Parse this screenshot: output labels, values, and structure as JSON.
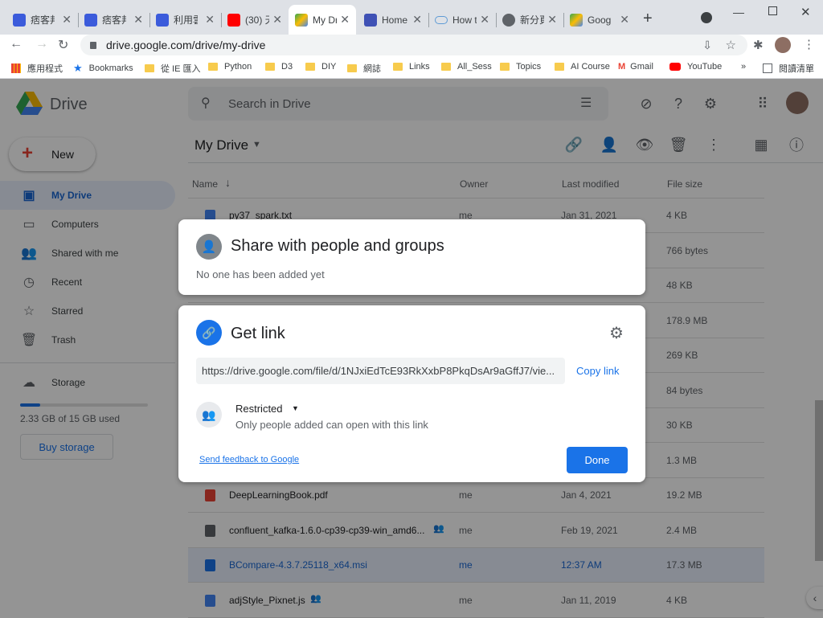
{
  "browser": {
    "tabs": [
      {
        "label": "痞客邦",
        "color": "#3b5bdb"
      },
      {
        "label": "痞客邦",
        "color": "#3b5bdb"
      },
      {
        "label": "利用雲",
        "color": "#3b5bdb"
      },
      {
        "label": "(30) 天",
        "color": "#ff0000"
      },
      {
        "label": "My Dri",
        "color": "#1a73e8"
      },
      {
        "label": "Home",
        "color": "#3f51b5"
      },
      {
        "label": "How t",
        "color": "#5f9bd5"
      },
      {
        "label": "新分頁",
        "color": "#5f6368"
      },
      {
        "label": "Googl",
        "color": "#1a73e8"
      }
    ],
    "url": "drive.google.com/drive/my-drive",
    "bookmarks": [
      "應用程式",
      "Bookmarks",
      "從 IE 匯入",
      "Python",
      "D3",
      "DIY",
      "網誌",
      "Links",
      "All_Sess",
      "Topics",
      "AI Course",
      "Gmail",
      "YouTube"
    ],
    "reading_list": "閱讀清單",
    "more": "»"
  },
  "drive": {
    "logo_text": "Drive",
    "search_placeholder": "Search in Drive",
    "new_label": "New",
    "breadcrumb": "My Drive",
    "nav": [
      "My Drive",
      "Computers",
      "Shared with me",
      "Recent",
      "Starred",
      "Trash",
      "Storage"
    ],
    "storage_text": "2.33 GB of 15 GB used",
    "storage_fraction": 0.155,
    "buy_storage": "Buy storage",
    "columns": [
      "Name",
      "Owner",
      "Last modified",
      "File size"
    ],
    "rows": [
      {
        "name": "py37_spark.txt",
        "owner": "me",
        "modified": "Jan 31, 2021",
        "size": "4 KB",
        "icon": "doc"
      },
      {
        "name": "",
        "owner": "",
        "modified": "",
        "size": "766 bytes",
        "icon": "none"
      },
      {
        "name": "",
        "owner": "",
        "modified": "",
        "size": "48 KB",
        "icon": "none"
      },
      {
        "name": "",
        "owner": "",
        "modified": "",
        "size": "178.9 MB",
        "icon": "none"
      },
      {
        "name": "",
        "owner": "",
        "modified": "",
        "size": "269 KB",
        "icon": "none"
      },
      {
        "name": "",
        "owner": "",
        "modified": "",
        "size": "84 bytes",
        "icon": "none"
      },
      {
        "name": "",
        "owner": "",
        "modified": "",
        "size": "30 KB",
        "icon": "none"
      },
      {
        "name": "",
        "owner": "",
        "modified": "",
        "size": "1.3 MB",
        "icon": "none"
      },
      {
        "name": "DeepLearningBook.pdf",
        "owner": "me",
        "modified": "Jan 4, 2021",
        "size": "19.2 MB",
        "icon": "pdf"
      },
      {
        "name": "confluent_kafka-1.6.0-cp39-cp39-win_amd6...",
        "owner": "me",
        "modified": "Feb 19, 2021",
        "size": "2.4 MB",
        "icon": "zip"
      },
      {
        "name": "BCompare-4.3.7.25118_x64.msi",
        "owner": "me",
        "modified": "12:37 AM",
        "size": "17.3 MB",
        "icon": "msi"
      },
      {
        "name": "adjStyle_Pixnet.js",
        "owner": "me",
        "modified": "Jan 11, 2019",
        "size": "4 KB",
        "icon": "doc"
      }
    ]
  },
  "share_dialog": {
    "title": "Share with people and groups",
    "subtitle": "No one has been added yet"
  },
  "link_dialog": {
    "title": "Get link",
    "url": "https://drive.google.com/file/d/1NJxiEdTcE93RkXxbP8PkqDsAr9aGffJ7/vie...",
    "copy_link": "Copy link",
    "access_label": "Restricted",
    "access_desc": "Only people added can open with this link",
    "feedback": "Send feedback to Google",
    "done": "Done"
  },
  "colors": {
    "accent": "#1a73e8",
    "selected_row": "#e8f0fe"
  }
}
